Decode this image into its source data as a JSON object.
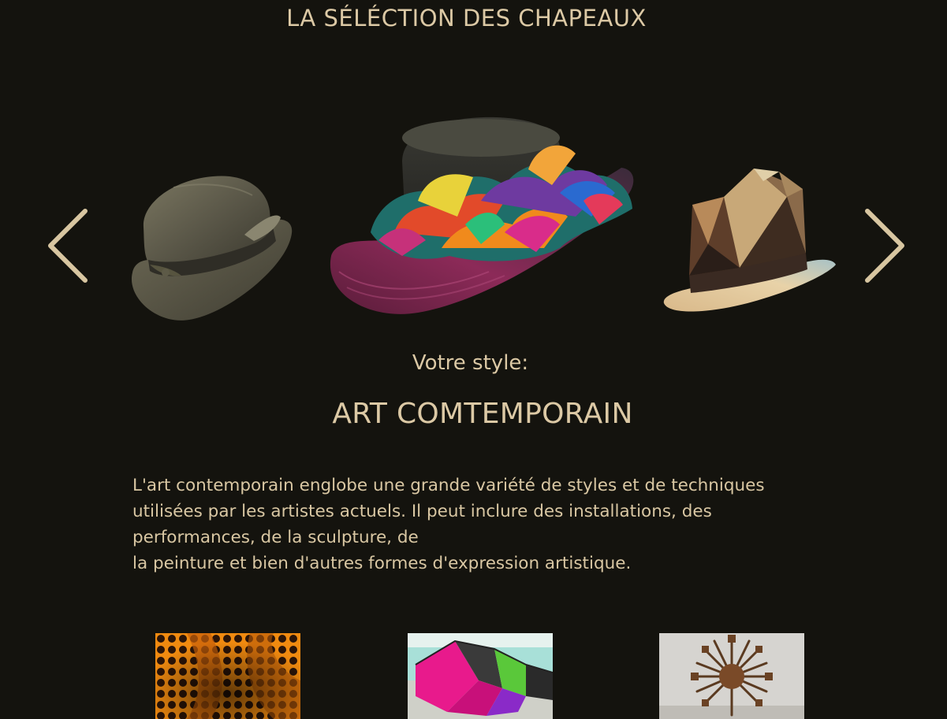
{
  "page": {
    "title": "LA SÉLÉCTION DES CHAPEAUX",
    "style_label": "Votre style:",
    "style_name": "ART COMTEMPORAIN",
    "description_lines": [
      "L'art contemporain englobe une grande variété de styles et de techniques",
      "utilisées par les artistes actuels. Il peut inclure des installations, des",
      "performances, de la sculpture, de",
      "la peinture et bien d'autres formes d'expression artistique."
    ]
  },
  "carousel": {
    "prev_icon": "chevron-left-icon",
    "next_icon": "chevron-right-icon",
    "hats": [
      "weathered-fedora",
      "colorful-ruffled-hat",
      "geometric-origami-hat"
    ]
  },
  "gallery": [
    "yayoi-kusama-dots",
    "neon-geometric-installation",
    "chairs-sculpture"
  ],
  "colors": {
    "background": "#14130e",
    "accent": "#d9c7a3",
    "arrow": "#d8c6a1"
  }
}
